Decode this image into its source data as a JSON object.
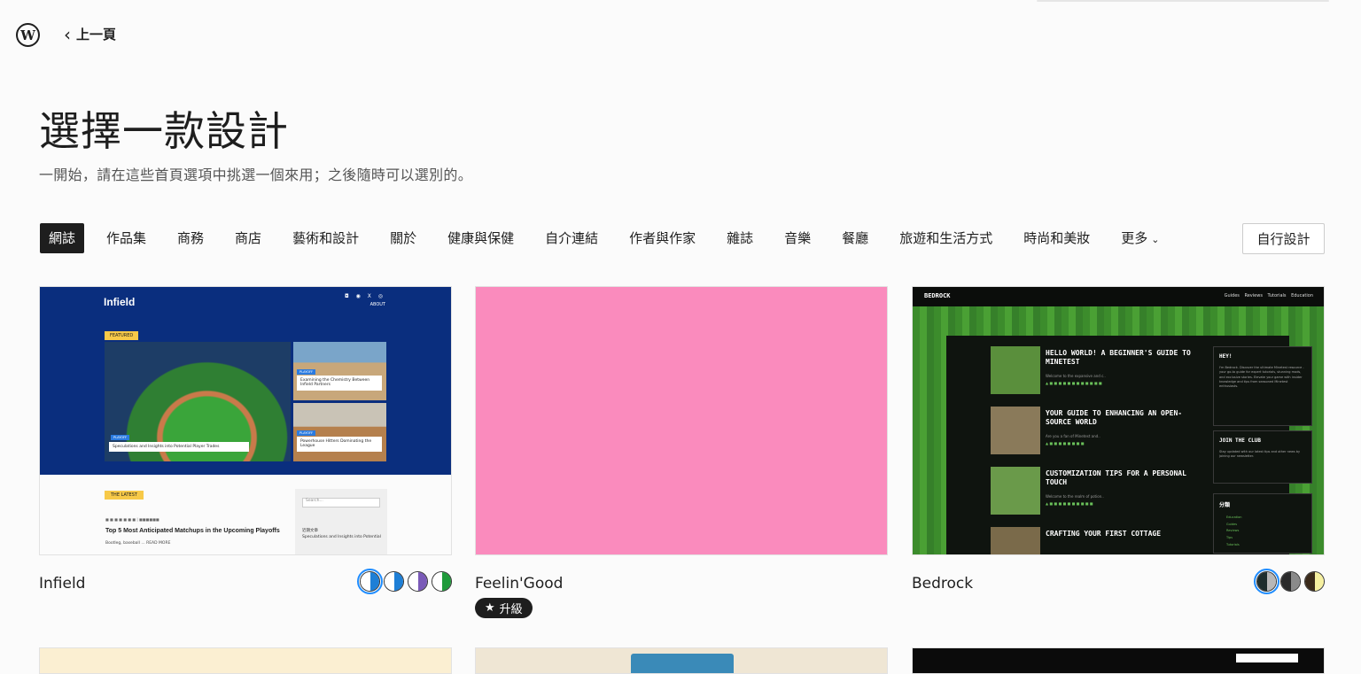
{
  "topbar": {
    "back_label": "上一頁"
  },
  "header": {
    "title": "選擇一款設計",
    "subtitle": "一開始，請在這些首頁選項中挑選一個來用；之後隨時可以選別的。"
  },
  "categories": {
    "items": [
      "網誌",
      "作品集",
      "商務",
      "商店",
      "藝術和設計",
      "關於",
      "健康與保健",
      "自介連結",
      "作者與作家",
      "雜誌",
      "音樂",
      "餐廳",
      "旅遊和生活方式",
      "時尚和美妝"
    ],
    "more_label": "更多",
    "active_index": 0,
    "custom_label": "自行設計"
  },
  "cards": [
    {
      "name": "Infield",
      "swatches": [
        {
          "left": "#ffffff",
          "right": "#1e7fd6"
        },
        {
          "left": "#ffffff",
          "right": "#1e7fd6"
        },
        {
          "left": "#ffffff",
          "right": "#7a5ab8"
        },
        {
          "left": "#ffffff",
          "right": "#1f9a3a"
        }
      ],
      "selected_swatch": 0,
      "preview": {
        "logo": "Infield",
        "about": "ABOUT",
        "icons": "◘ ◉ X ◎",
        "featured": "FEATURED",
        "tag": "PLAYOFF",
        "cap_main": "Speculations and Insights into Potential Player Trades",
        "cap_2": "Examining the Chemistry Between Infield Partners",
        "cap_3": "Powerhouse Hitters Dominating the League",
        "latest": "THE LATEST",
        "search": "Search...",
        "meta": "■ ■ ■ ■ ■ ■ ■ | ■■■■■■",
        "headline": "Top 5 Most Anticipated Matchups in the Upcoming Playoffs",
        "excerpt": "Bootleg, baseball ... READ MORE",
        "side_title": "近期文章",
        "side_text": "Speculations and Insights into Potential"
      }
    },
    {
      "name": "Feelin'Good",
      "badge": "升級",
      "badge_icon": "★",
      "preview_color": "#fa8bbd"
    },
    {
      "name": "Bedrock",
      "swatches": [
        {
          "left": "#1e2e2e",
          "right": "#b8b8b8"
        },
        {
          "left": "#2a2a2a",
          "right": "#8a8a8a"
        },
        {
          "left": "#3a2a1a",
          "right": "#f6f0a0"
        }
      ],
      "selected_swatch": 0,
      "preview": {
        "logo": "BEDROCK",
        "nav": "Guides Reviews Tutorials Education",
        "posts": [
          {
            "title": "HELLO WORLD! A BEGINNER'S GUIDE TO MINETEST",
            "sub": "Welcome to the expansive and c..",
            "meta": "▲ ■ ■ ■ ■  ■ ■ ■ ■ ■ ■ ■ ■",
            "img": "#5a8f3c"
          },
          {
            "title": "YOUR GUIDE TO ENHANCING AN OPEN-SOURCE WORLD",
            "sub": "Are you a fan of Minetest and..",
            "meta": "▲ ■ ■ ■ ■  ■ ■ ■ ■",
            "img": "#8a7a5a"
          },
          {
            "title": "CUSTOMIZATION TIPS FOR A PERSONAL TOUCH",
            "sub": "Welcome to the realm of potion..",
            "meta": "▲ ■ ■ ■ ■  ■ ■ ■ ■ ■ ■",
            "img": "#6a9a4a"
          },
          {
            "title": "CRAFTING YOUR FIRST COTTAGE",
            "sub": "Welcome to our step-by-step gu..",
            "meta": "▲ ■ ■ ■ ■  ■ ■ ■ ■ ■ ■ ■ ■",
            "img": "#7a6a4a"
          }
        ],
        "box1_title": "HEY!",
        "box1_text": "I'm Bedrock. Discover the ultimate Minetest resource - your go-to guide for expert tutorials, stunning mods, and exclusive stories. Elevate your game with insider knowledge and tips from seasoned Minetest enthusiasts.",
        "box2_title": "JOIN THE CLUB",
        "box2_text": "Stay updated with our latest tips and other news by joining our newsletter.",
        "box3_title": "分類",
        "box3_links": [
          "Education",
          "Guides",
          "Reviews",
          "Tips",
          "Tutorials"
        ]
      }
    }
  ],
  "colors": {
    "text": "#1e1e1e",
    "accent": "#1e8cff",
    "infield_blue": "#0a2e7e",
    "feelin_pink": "#fa8bbd",
    "bedrock_green": "#3c8c2c"
  }
}
